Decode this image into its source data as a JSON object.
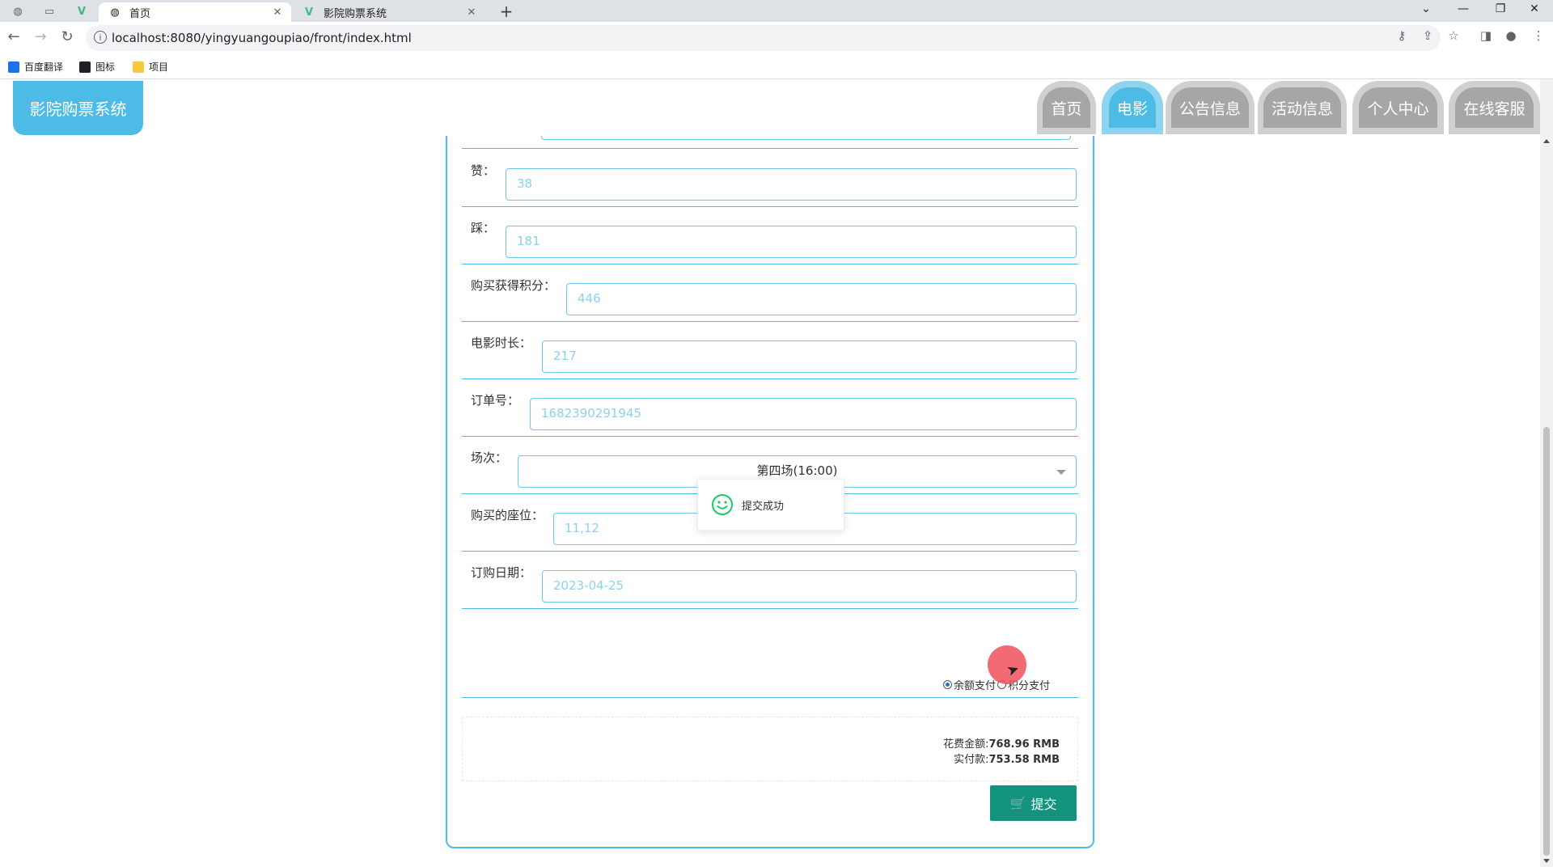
{
  "browser": {
    "tabs": [
      {
        "label": "首页",
        "active": true
      },
      {
        "label": "影院购票系统",
        "active": false
      }
    ],
    "url": "localhost:8080/yingyuangoupiao/front/index.html",
    "bookmarks": [
      {
        "label": "百度翻译",
        "color": "#1a73e8"
      },
      {
        "label": "图标",
        "color": "#202124"
      },
      {
        "label": "项目",
        "color": "#f9c840"
      }
    ]
  },
  "header": {
    "logo": "影院购票系统",
    "nav": [
      {
        "label": "首页",
        "active": false
      },
      {
        "label": "电影",
        "active": true
      },
      {
        "label": "公告信息",
        "active": false
      },
      {
        "label": "活动信息",
        "active": false
      },
      {
        "label": "个人中心",
        "active": false
      },
      {
        "label": "在线客服",
        "active": false
      }
    ]
  },
  "form": {
    "zan": {
      "label": "赞：",
      "value": "38"
    },
    "cai": {
      "label": "踩：",
      "value": "181"
    },
    "points": {
      "label": "购买获得积分：",
      "value": "446"
    },
    "duration": {
      "label": "电影时长：",
      "value": "217"
    },
    "order_no": {
      "label": "订单号：",
      "value": "1682390291945"
    },
    "session": {
      "label": "场次：",
      "value": "第四场(16:00)"
    },
    "seats": {
      "label": "购买的座位：",
      "value": "11,12"
    },
    "order_date": {
      "label": "订购日期：",
      "value": "2023-04-25"
    },
    "pay_options": [
      {
        "label": "余额支付",
        "selected": true
      },
      {
        "label": "积分支付",
        "selected": false
      }
    ],
    "summary": {
      "cost_label": "花费金额:",
      "cost_value": "768.96 RMB",
      "paid_label": "实付款:",
      "paid_value": "753.58 RMB"
    },
    "submit_label": "提交"
  },
  "toast": {
    "message": "提交成功"
  },
  "colors": {
    "accent": "#4cbce6",
    "submit": "#14947f",
    "success": "#13ce66"
  }
}
